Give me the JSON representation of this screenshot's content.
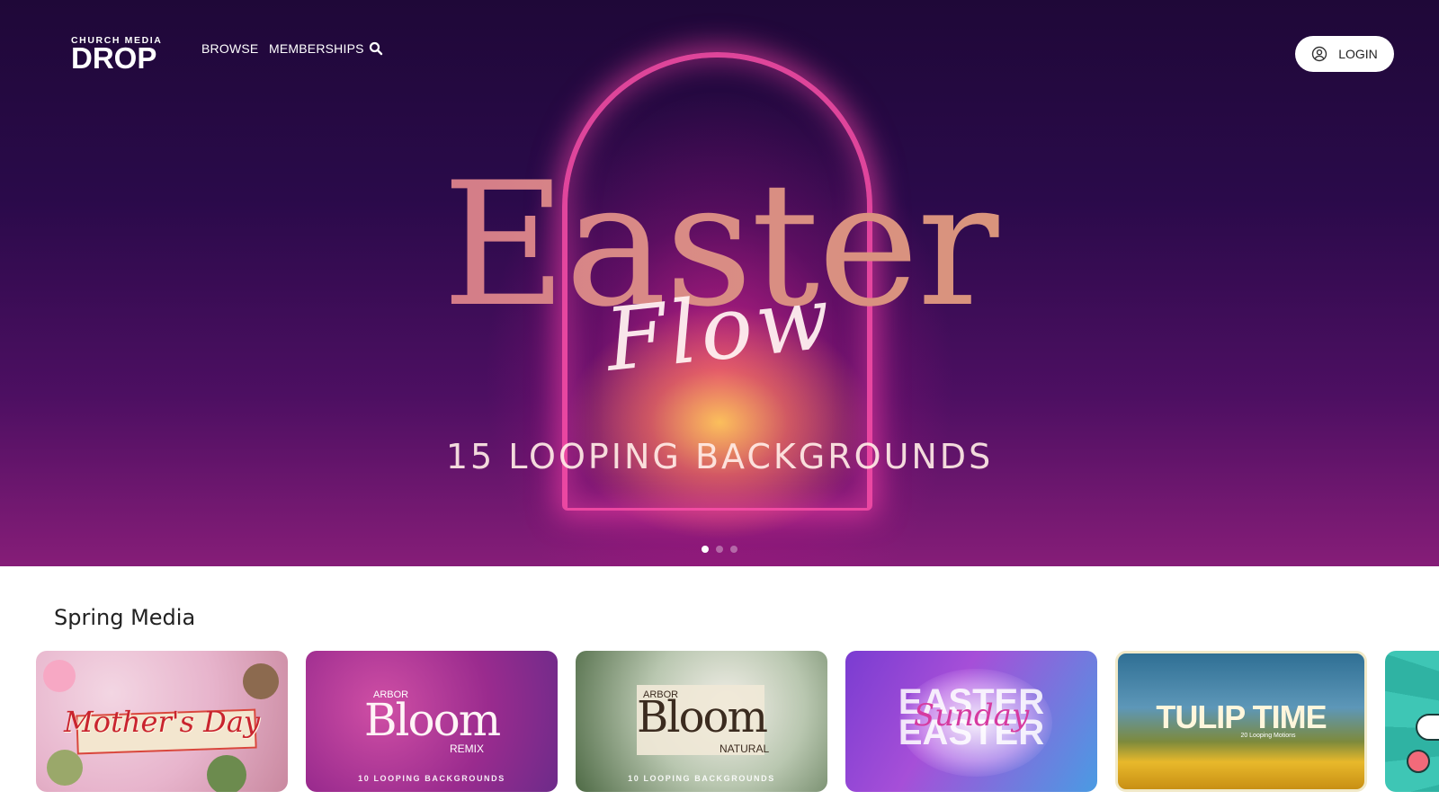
{
  "brand": {
    "small": "CHURCH MEDIA",
    "big": "DROP"
  },
  "nav": {
    "browse": "BROWSE",
    "memberships": "MEMBERSHIPS",
    "login": "LOGIN"
  },
  "hero": {
    "title": "Easter",
    "script": "Flow",
    "subtitle": "15 LOOPING BACKGROUNDS",
    "slides": 3,
    "active_slide": 1
  },
  "section": {
    "title": "Spring Media"
  },
  "cards": [
    {
      "title": "Mother's Day"
    },
    {
      "pre": "ARBOR",
      "title": "Bloom",
      "tag": "REMIX",
      "sub": "10 LOOPING BACKGROUNDS"
    },
    {
      "pre": "ARBOR",
      "title": "Bloom",
      "tag": "NATURAL",
      "sub": "10 LOOPING BACKGROUNDS"
    },
    {
      "title": "EASTER\nEASTER",
      "script": "Sunday"
    },
    {
      "title": "TULIP TIME",
      "small": "20 Looping Motions"
    },
    {
      "title": ""
    }
  ],
  "colors": {
    "hero_top": "#1f0838",
    "hero_bottom": "#861d78",
    "accent_pink": "#ff50aa"
  }
}
